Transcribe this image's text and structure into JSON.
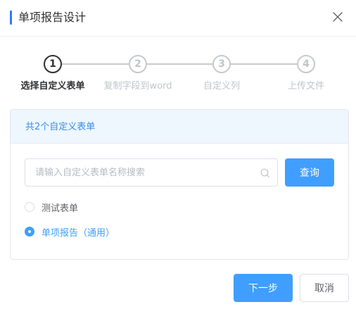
{
  "dialog": {
    "title": "单项报告设计",
    "accent_color": "#2f7cf6"
  },
  "steps": [
    {
      "number": "1",
      "label": "选择自定义表单",
      "active": true
    },
    {
      "number": "2",
      "label": "复制字段到word",
      "active": false
    },
    {
      "number": "3",
      "label": "自定义列",
      "active": false
    },
    {
      "number": "4",
      "label": "上传文件",
      "active": false
    }
  ],
  "card": {
    "header": "共2个自定义表单",
    "search": {
      "placeholder": "请输入自定义表单名称搜索",
      "value": ""
    },
    "query_label": "查询",
    "options": [
      {
        "label": "测试表单",
        "checked": false
      },
      {
        "label": "单项报告（通用）",
        "checked": true
      }
    ]
  },
  "footer": {
    "next_label": "下一步",
    "cancel_label": "取消"
  },
  "colors": {
    "primary": "#409eff",
    "header_bg": "#eef6fe",
    "inactive": "#c0c4cc"
  }
}
